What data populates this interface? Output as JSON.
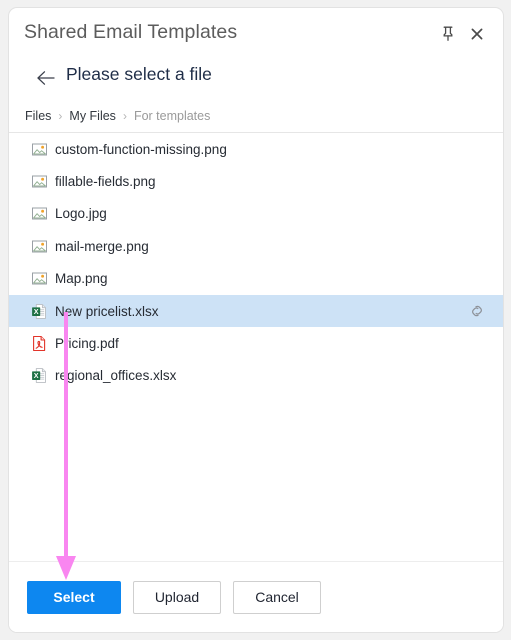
{
  "window": {
    "app_title": "Shared Email Templates",
    "pin_icon": "pin-icon",
    "close_icon": "close-icon"
  },
  "subheader": {
    "back_icon": "back-arrow-icon",
    "page_title": "Please select a file"
  },
  "breadcrumb": {
    "separator": "›",
    "items": [
      {
        "label": "Files",
        "current": false
      },
      {
        "label": "My Files",
        "current": false
      },
      {
        "label": "For templates",
        "current": true
      }
    ]
  },
  "file_list": {
    "files": [
      {
        "name": "custom-function-missing.png",
        "type": "image",
        "selected": false,
        "has_link": false
      },
      {
        "name": "fillable-fields.png",
        "type": "image",
        "selected": false,
        "has_link": false
      },
      {
        "name": "Logo.jpg",
        "type": "image",
        "selected": false,
        "has_link": false
      },
      {
        "name": "mail-merge.png",
        "type": "image",
        "selected": false,
        "has_link": false
      },
      {
        "name": "Map.png",
        "type": "image",
        "selected": false,
        "has_link": false
      },
      {
        "name": "New pricelist.xlsx",
        "type": "excel",
        "selected": true,
        "has_link": true
      },
      {
        "name": "Pricing.pdf",
        "type": "pdf",
        "selected": false,
        "has_link": false
      },
      {
        "name": "regional_offices.xlsx",
        "type": "excel",
        "selected": false,
        "has_link": false
      }
    ],
    "link_icon": "link-icon"
  },
  "footer": {
    "select_label": "Select",
    "upload_label": "Upload",
    "cancel_label": "Cancel"
  },
  "annotation": {
    "arrow_color": "#f986f0",
    "points_to": "Select"
  },
  "colors": {
    "primary_button": "#0d87f0",
    "selected_row": "#cde2f6",
    "excel_green": "#1e7145",
    "pdf_red": "#e2342a",
    "annotation_pink": "#f986f0"
  }
}
